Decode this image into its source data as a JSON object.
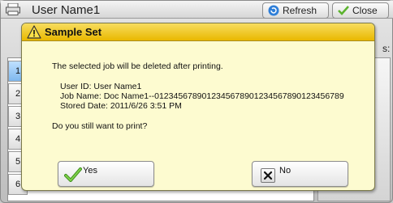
{
  "window": {
    "title": "User Name1",
    "refresh_label": "Refresh",
    "close_label": "Close",
    "right_label": "s:"
  },
  "job_list": {
    "row_numbers": [
      "1",
      "2",
      "3",
      "4",
      "5",
      "6"
    ],
    "selected_row": "1"
  },
  "dialog": {
    "title": "Sample Set",
    "message": "The selected job will be deleted after printing.",
    "user_id": "User ID: User Name1",
    "job_name": "Job Name: Doc Name1--0123456789012345678901234567890123456789",
    "stored_date": "Stored Date: 2011/6/26 3:51 PM",
    "question": "Do you still want to print?",
    "yes_label": "Yes",
    "no_label": "No",
    "icons": {
      "warning": "warning-icon",
      "yes": "checkmark-icon",
      "no": "x-icon"
    },
    "colors": {
      "title_bar": "#e9b800",
      "body": "#fdfbd0",
      "check": "#5cb32e"
    }
  }
}
